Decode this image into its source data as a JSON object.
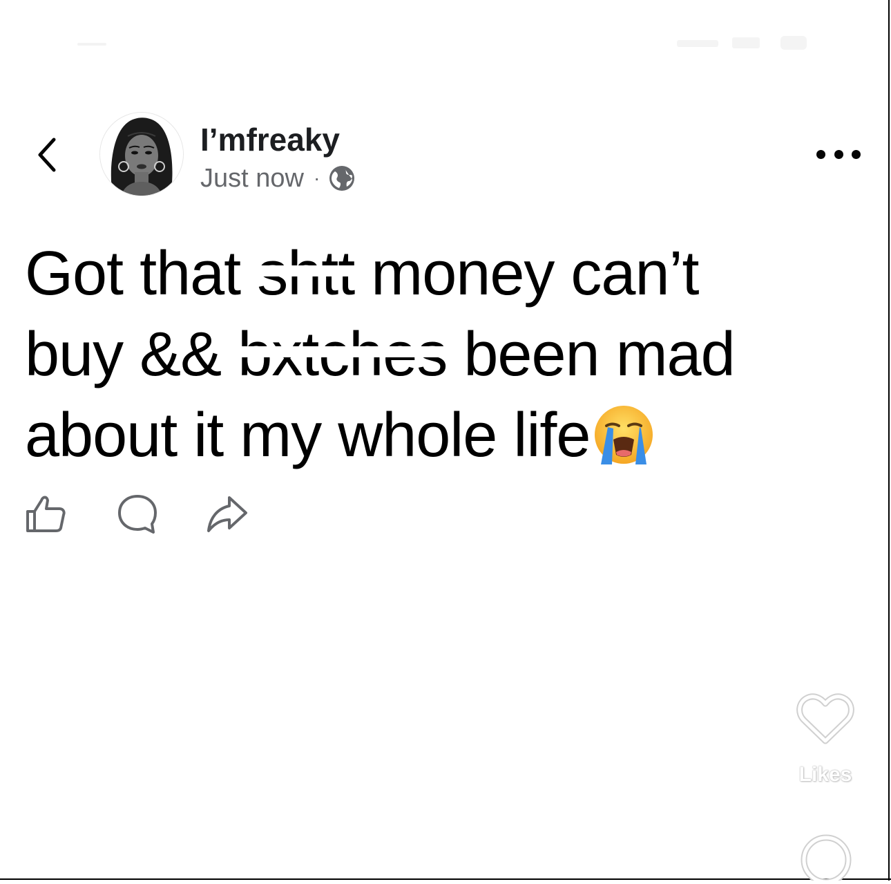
{
  "author": {
    "name": "I’mfreaky",
    "timestamp": "Just now",
    "separator": "·",
    "privacy_icon": "globe-icon"
  },
  "header": {
    "back_icon": "chevron-left-icon",
    "more_icon": "more-horizontal-icon"
  },
  "post": {
    "line1_a": "Got that ",
    "line1_censored": "shtt",
    "line1_b": " money can’t",
    "line2_a": "buy && ",
    "line2_censored": "bxtches",
    "line2_b": " been mad",
    "line3": "about it my whole life",
    "emoji": "loudly-crying-face"
  },
  "actions": [
    {
      "name": "like",
      "icon": "thumbs-up-icon"
    },
    {
      "name": "comment",
      "icon": "comment-bubble-icon"
    },
    {
      "name": "share",
      "icon": "share-arrow-icon"
    }
  ],
  "side_rail": {
    "like_icon": "heart-icon",
    "likes_label": "Likes",
    "comment_icon": "comment-icon"
  },
  "colors": {
    "name": "#1c1e21",
    "meta": "#65676b",
    "icon_stroke": "#65676b",
    "background": "#ffffff"
  }
}
